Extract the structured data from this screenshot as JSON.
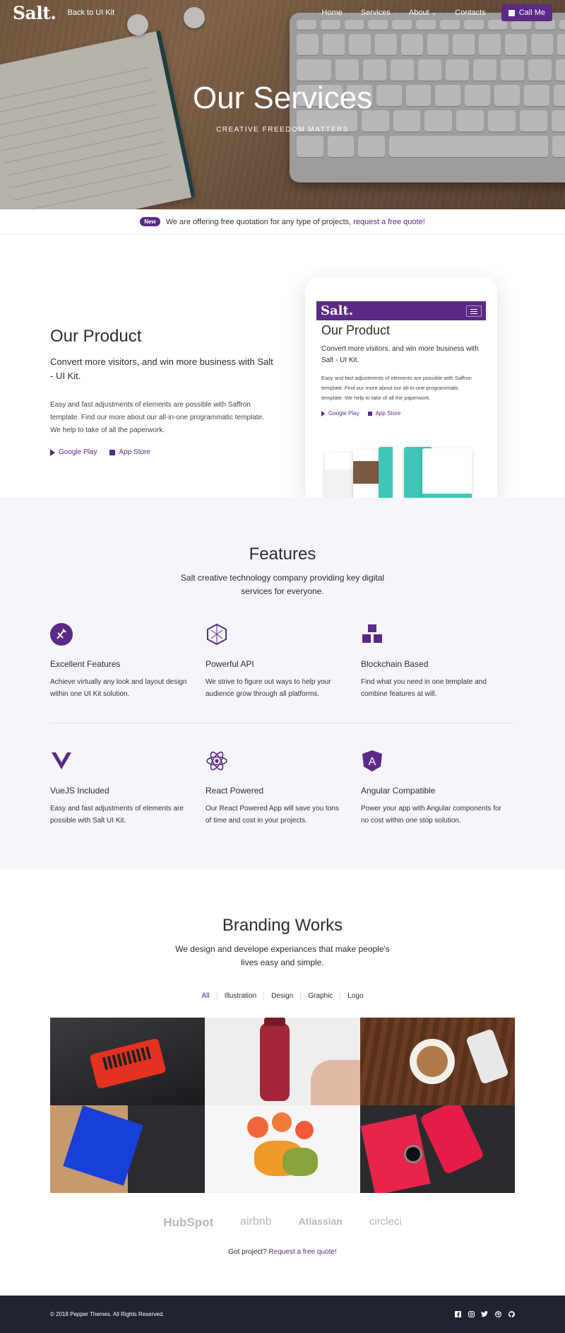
{
  "nav": {
    "logo": "Salt.",
    "back": "Back to UI Kit",
    "items": [
      "Home",
      "Services",
      "About",
      "Contacts"
    ],
    "about_caret": "⌄",
    "cta": "Call Me"
  },
  "hero": {
    "title": "Our Services",
    "subtitle": "CREATIVE FREEDOM MATTERS"
  },
  "announce": {
    "badge": "New",
    "text": "We are offering free quotation for any type of projects,",
    "link": "request a free quote!"
  },
  "product": {
    "title": "Our Product",
    "lead": "Convert more visitors, and win more business with Salt - UI Kit.",
    "body": "Easy and fast adjustments of elements are possible with Saffron template. Find our more about our all-in-one programmatic template. We help to take of all the paperwork.",
    "store1": "Google Play",
    "store2": "App Store",
    "device_logo": "Salt."
  },
  "features": {
    "title": "Features",
    "subtitle": "Salt creative technology company providing key digital services for everyone.",
    "items": [
      {
        "icon": "excellent-features-icon",
        "title": "Excellent Features",
        "text": "Achieve virtually any look and layout design within one UI Kit solution."
      },
      {
        "icon": "powerful-api-icon",
        "title": "Powerful API",
        "text": "We strive to figure out ways to help your audience grow through all platforms."
      },
      {
        "icon": "blockchain-icon",
        "title": "Blockchain Based",
        "text": "Find what you need in one template and combine features at will."
      },
      {
        "icon": "vuejs-icon",
        "title": "VueJS Included",
        "text": "Easy and fast adjustments of elements are possible with Salt UI Kit."
      },
      {
        "icon": "react-icon",
        "title": "React Powered",
        "text": "Our React Powered App will save you tons of time and cost in your projects."
      },
      {
        "icon": "angular-icon",
        "title": "Angular Compatible",
        "text": "Power your app with Angular components for no cost within one stop solution."
      }
    ]
  },
  "branding": {
    "title": "Branding Works",
    "subtitle": "We design and develope experiances that make people's lives easy and simple.",
    "filters": [
      "All",
      "Illustration",
      "Design",
      "Graphic",
      "Logo"
    ],
    "logos": [
      "HubSpot",
      "airbnb",
      "Atlassian",
      "circleci"
    ],
    "got_project": "Got project?",
    "quote_link": "Request a free quote!"
  },
  "footer": {
    "copyright": "© 2018 Pepper Themes. All Rights Reserved."
  },
  "colors": {
    "accent": "#5b2a86",
    "footer": "#1f2330",
    "features_bg": "#f4f6f9"
  }
}
